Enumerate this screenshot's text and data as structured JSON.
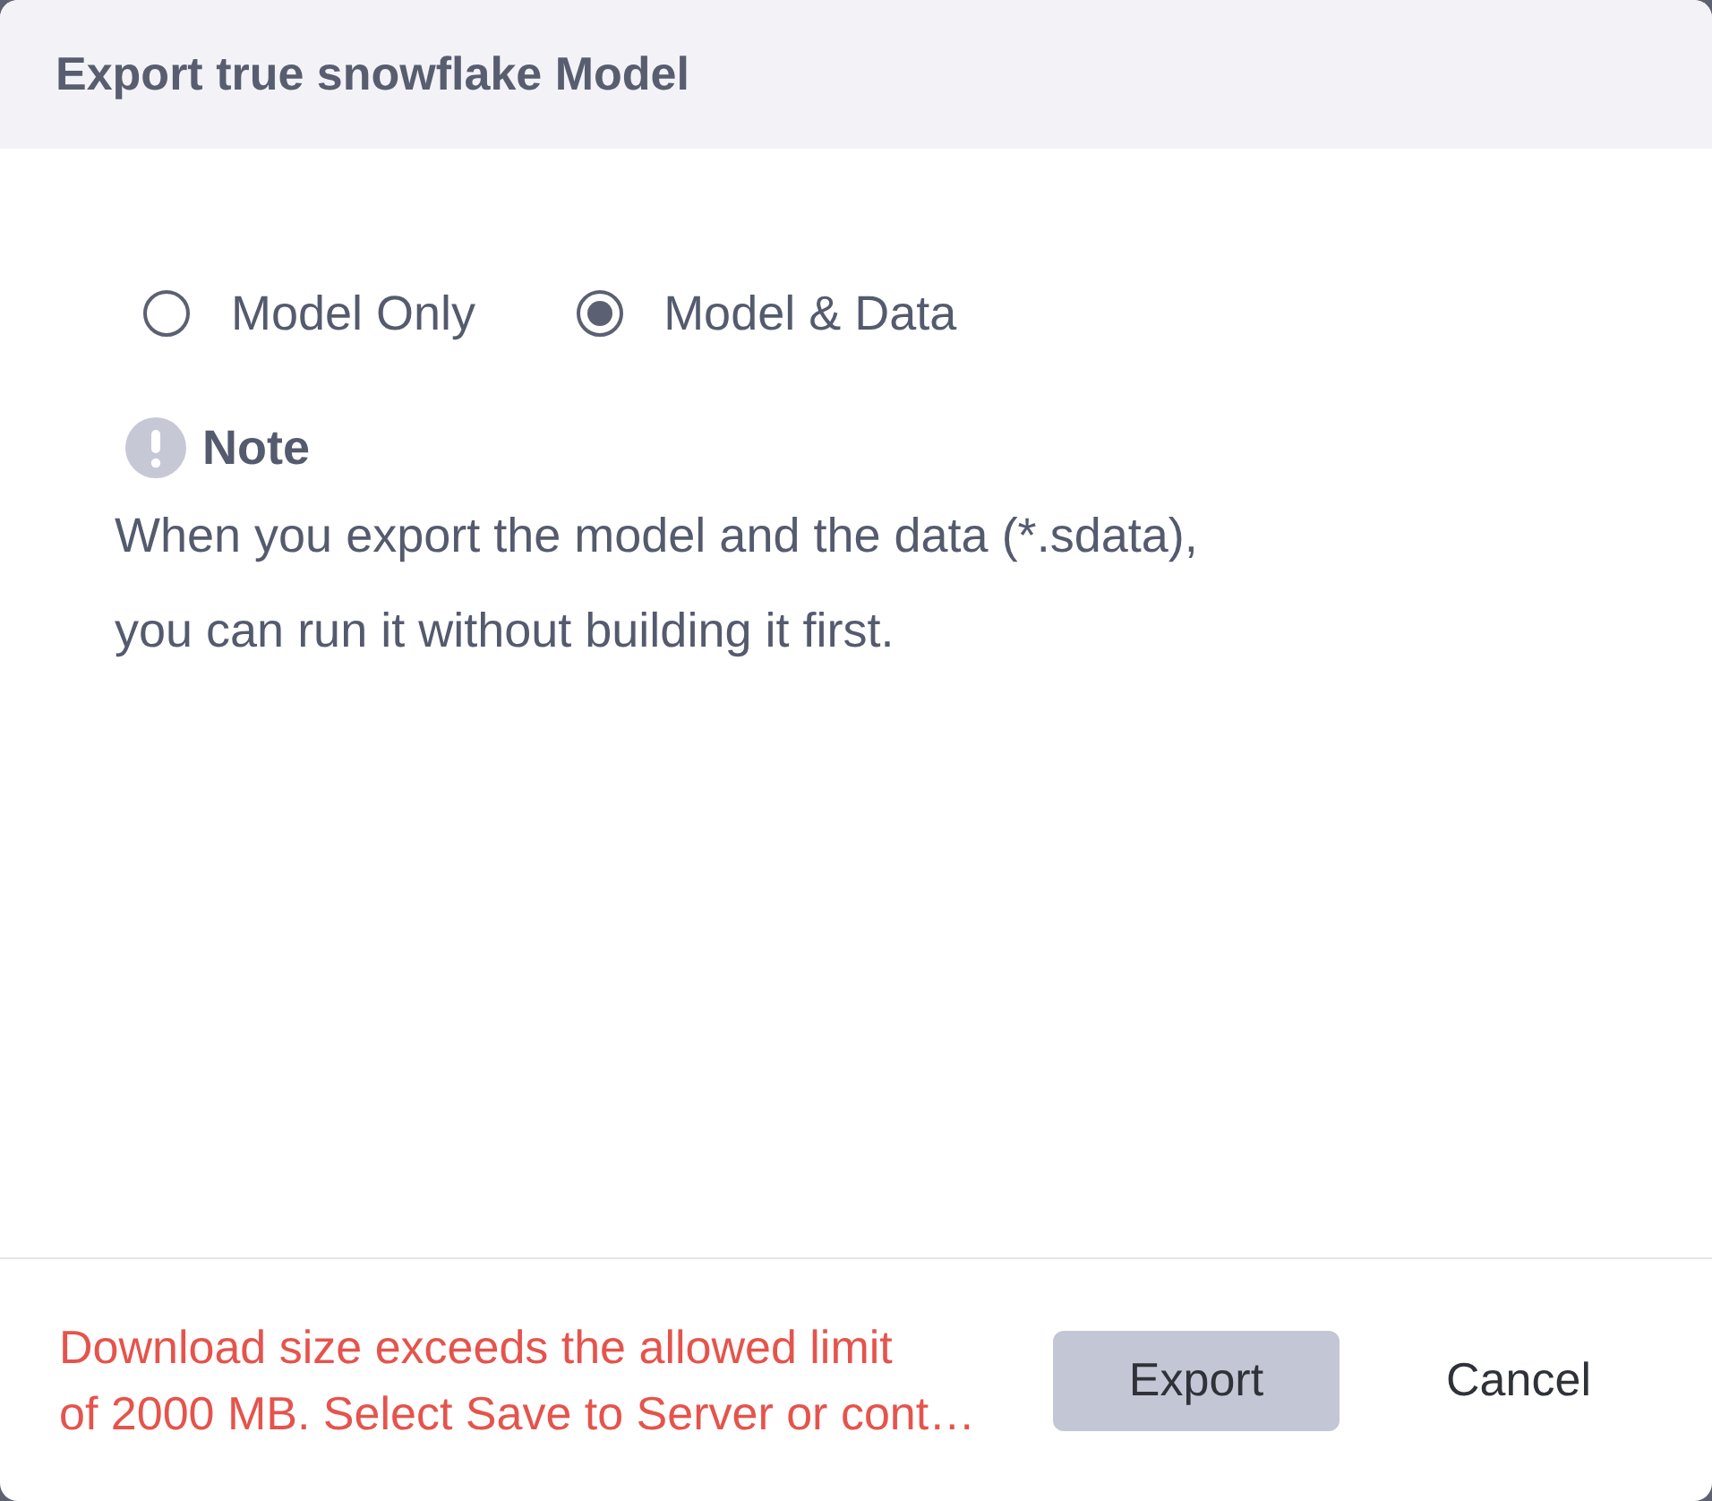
{
  "dialog": {
    "title": "Export true snowflake Model"
  },
  "export_options": [
    {
      "label": "Model Only",
      "selected": false
    },
    {
      "label": "Model & Data",
      "selected": true
    }
  ],
  "note": {
    "heading": "Note",
    "text": "When you export the model and the data (*.sdata),\nyou can run it without building it first."
  },
  "footer": {
    "error": "Download size exceeds the allowed limit\nof 2000 MB. Select Save to Server or cont…",
    "buttons": [
      {
        "kind": "primary",
        "label": "Export",
        "disabled": true
      },
      {
        "kind": "plain",
        "label": "Cancel",
        "disabled": false
      }
    ]
  }
}
